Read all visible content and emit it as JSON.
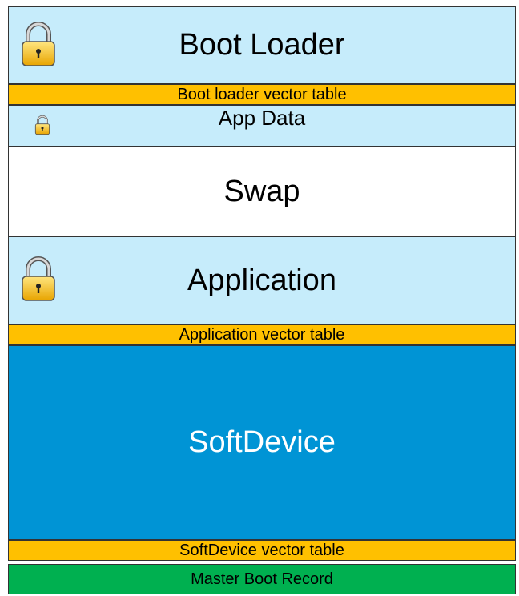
{
  "colors": {
    "light_blue": "#c6ecfb",
    "orange": "#ffc000",
    "blue": "#0094d5",
    "green": "#00b050",
    "white": "#ffffff"
  },
  "regions": {
    "boot_loader": "Boot Loader",
    "boot_loader_vector_table": "Boot loader vector table",
    "app_data": "App Data",
    "swap": "Swap",
    "application": "Application",
    "application_vector_table": "Application vector table",
    "softdevice": "SoftDevice",
    "softdevice_vector_table": "SoftDevice vector table",
    "master_boot_record": "Master Boot Record"
  },
  "icons": {
    "lock": "lock-icon"
  }
}
